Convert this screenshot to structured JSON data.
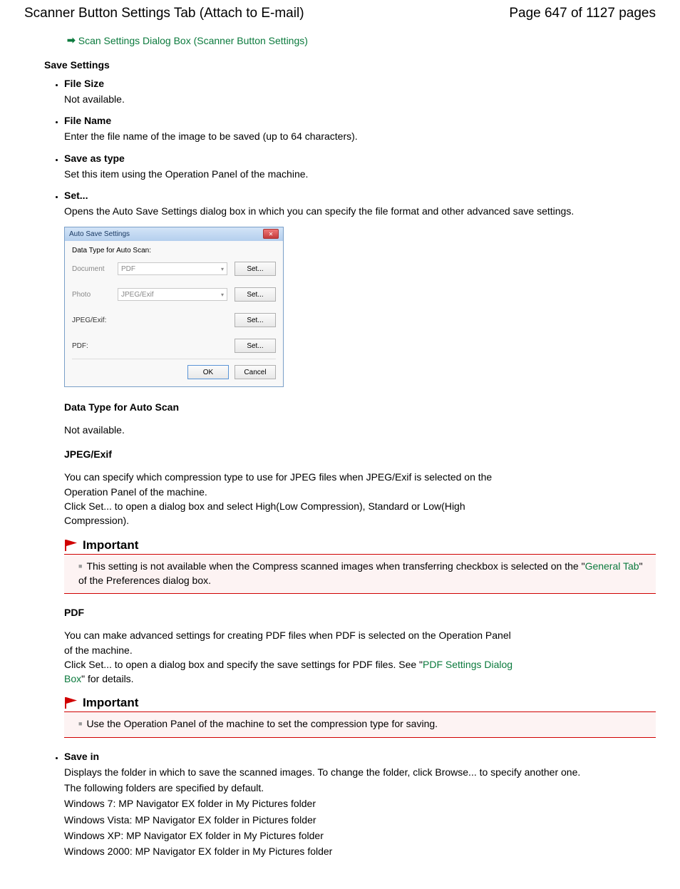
{
  "header": {
    "title": "Scanner Button Settings Tab (Attach to E-mail)",
    "page": "Page 647 of 1127 pages"
  },
  "topLink": {
    "text": "Scan Settings Dialog Box (Scanner Button Settings)"
  },
  "saveSettings": {
    "heading": "Save Settings",
    "items": {
      "fileSize": {
        "title": "File Size",
        "body": "Not available."
      },
      "fileName": {
        "title": "File Name",
        "body": "Enter the file name of the image to be saved (up to 64 characters)."
      },
      "saveAsType": {
        "title": "Save as type",
        "body": "Set this item using the Operation Panel of the machine."
      },
      "set": {
        "title": "Set...",
        "body": "Opens the Auto Save Settings dialog box in which you can specify the file format and other advanced save settings."
      }
    }
  },
  "dialog": {
    "title": "Auto Save Settings",
    "dataTypeLabel": "Data Type for Auto Scan:",
    "documentLabel": "Document",
    "documentValue": "PDF",
    "photoLabel": "Photo",
    "photoValue": "JPEG/Exif",
    "jpegExifLabel": "JPEG/Exif:",
    "pdfLabel": "PDF:",
    "setBtn": "Set...",
    "okBtn": "OK",
    "cancelBtn": "Cancel"
  },
  "dataType": {
    "heading": "Data Type for Auto Scan",
    "body": "Not available."
  },
  "jpegExif": {
    "heading": "JPEG/Exif",
    "body1": "You can specify which compression type to use for JPEG files when JPEG/Exif is selected on the Operation Panel of the machine.",
    "body2": "Click Set... to open a dialog box and select High(Low Compression), Standard or Low(High Compression)."
  },
  "important1": {
    "heading": "Important",
    "textPre": "This setting is not available when the Compress scanned images when transferring checkbox is selected on the \"",
    "link": "General Tab",
    "textPost": "\" of the Preferences dialog box."
  },
  "pdf": {
    "heading": "PDF",
    "body1": "You can make advanced settings for creating PDF files when PDF is selected on the Operation Panel of the machine.",
    "body2Pre": "Click Set... to open a dialog box and specify the save settings for PDF files. See \"",
    "body2Link": "PDF Settings Dialog Box",
    "body2Post": "\" for details."
  },
  "important2": {
    "heading": "Important",
    "text": "Use the Operation Panel of the machine to set the compression type for saving."
  },
  "saveIn": {
    "title": "Save in",
    "p1": "Displays the folder in which to save the scanned images. To change the folder, click Browse... to specify another one.",
    "p2": "The following folders are specified by default.",
    "p3": "Windows 7: MP Navigator EX folder in My Pictures folder",
    "p4": "Windows Vista: MP Navigator EX folder in Pictures folder",
    "p5": "Windows XP: MP Navigator EX folder in My Pictures folder",
    "p6": "Windows 2000: MP Navigator EX folder in My Pictures folder"
  }
}
